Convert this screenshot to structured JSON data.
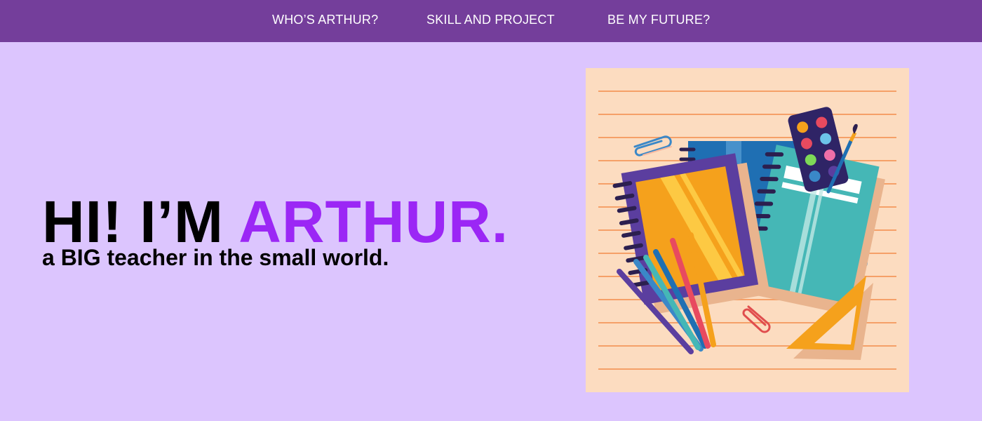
{
  "nav": {
    "items": [
      {
        "label": "WHO’S ARTHUR?"
      },
      {
        "label": "SKILL AND PROJECT"
      },
      {
        "label": "BE MY FUTURE?"
      }
    ]
  },
  "hero": {
    "title_prefix": "HI! I’M ",
    "title_name": "ARTHUR.",
    "subtitle": "a BIG teacher in the small world."
  },
  "colors": {
    "nav_background": "#743e9b",
    "page_background": "#dcc5fe",
    "accent": "#9b27f5",
    "paper": "#fcdcc0"
  },
  "illustration": {
    "icons": [
      "notebook-icon",
      "pencils-icon",
      "paint-palette-icon",
      "paintbrush-icon",
      "paperclip-icon",
      "ruler-triangle-icon"
    ]
  }
}
